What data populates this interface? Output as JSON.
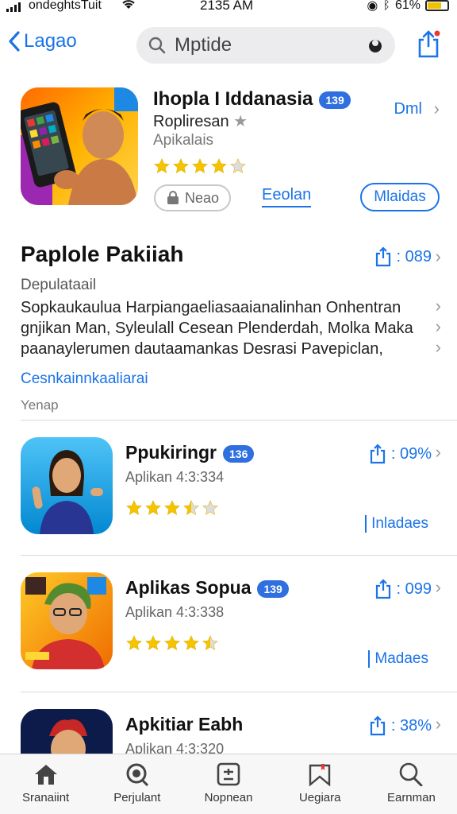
{
  "status_bar": {
    "carrier": "ondeghtsTuit",
    "time": "2135 AM",
    "battery": "61%"
  },
  "nav": {
    "back_label": "Lagao",
    "search_value": "Mptide"
  },
  "featured": {
    "title": "Ihopla I Iddanasia",
    "badge": "139",
    "subtitle": "Ropliresan",
    "category": "Apikalais",
    "right_link": "Dml",
    "rating": 4,
    "buttons": {
      "grey": "Neao",
      "link": "Eeolan",
      "blue": "Mlaidas"
    }
  },
  "section": {
    "heading": "Paplole Pakiiah",
    "meta": "089",
    "sublabel": "Depulataail",
    "description_lines": [
      "Sopkaukaulua Harpiangaeliasaaianalinhan Onhentran",
      "gnjikan Man, Syleulall Cesean Plenderdah, Molka Maka",
      "paanaylerumen dautaamankas Desrasi Pavepiclan,"
    ],
    "see_more": "Cesnkainnkaaliarai",
    "footer": "Yenap"
  },
  "apps": [
    {
      "title": "Ppukiringr",
      "badge": "136",
      "sub": "Aplikan 4:3:334",
      "rating": 3.5,
      "meta": "09%",
      "action": "Inladaes"
    },
    {
      "title": "Aplikas Sopua",
      "badge": "139",
      "sub": "Aplikan 4:3:338",
      "rating": 4.5,
      "meta": "099",
      "action": "Madaes"
    },
    {
      "title": "Apkitiar Eabh",
      "sub": "Aplikan 4:3:320",
      "meta": "38%"
    }
  ],
  "tabs": [
    {
      "label": "Sranaiint",
      "icon": "home-icon"
    },
    {
      "label": "Perjulant",
      "icon": "search-lens-icon"
    },
    {
      "label": "Nopnean",
      "icon": "calculator-icon"
    },
    {
      "label": "Uegiara",
      "icon": "bookmark-flag-icon"
    },
    {
      "label": "Earnman",
      "icon": "search-icon"
    }
  ],
  "colors": {
    "accent": "#1a73e8",
    "star": "#f5c300",
    "badge": "#2f6fe0"
  }
}
